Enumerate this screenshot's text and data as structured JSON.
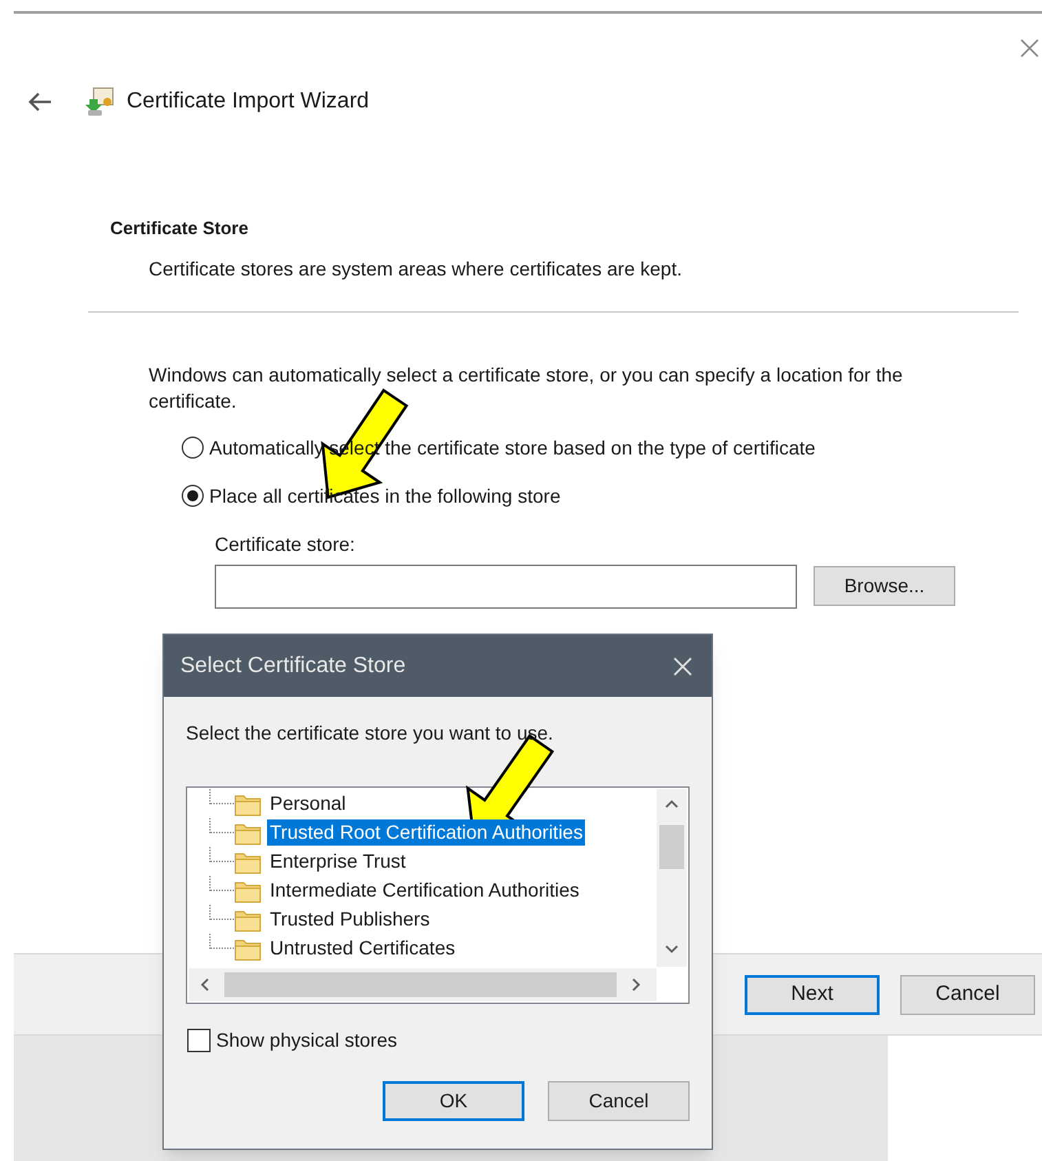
{
  "window": {
    "title": "Certificate Import Wizard"
  },
  "section": {
    "heading": "Certificate Store",
    "description": "Certificate stores are system areas where certificates are kept."
  },
  "intro": "Windows can automatically select a certificate store, or you can specify a location for the certificate.",
  "options": [
    {
      "label": "Automatically select the certificate store based on the type of certificate",
      "selected": false
    },
    {
      "label": "Place all certificates in the following store",
      "selected": true
    }
  ],
  "store_field": {
    "label": "Certificate store:"
  },
  "browse_button": "Browse...",
  "footer_buttons": [
    {
      "label": "Next",
      "default": true
    },
    {
      "label": "Cancel",
      "default": false
    }
  ],
  "dialog": {
    "title": "Select Certificate Store",
    "prompt": "Select the certificate store you want to use.",
    "stores": [
      {
        "label": "Personal",
        "selected": false
      },
      {
        "label": "Trusted Root Certification Authorities",
        "selected": true
      },
      {
        "label": "Enterprise Trust",
        "selected": false
      },
      {
        "label": "Intermediate Certification Authorities",
        "selected": false
      },
      {
        "label": "Trusted Publishers",
        "selected": false
      },
      {
        "label": "Untrusted Certificates",
        "selected": false
      }
    ],
    "show_physical_stores": {
      "label": "Show physical stores",
      "checked": false
    },
    "buttons": [
      {
        "label": "OK",
        "default": true
      },
      {
        "label": "Cancel",
        "default": false
      }
    ]
  }
}
